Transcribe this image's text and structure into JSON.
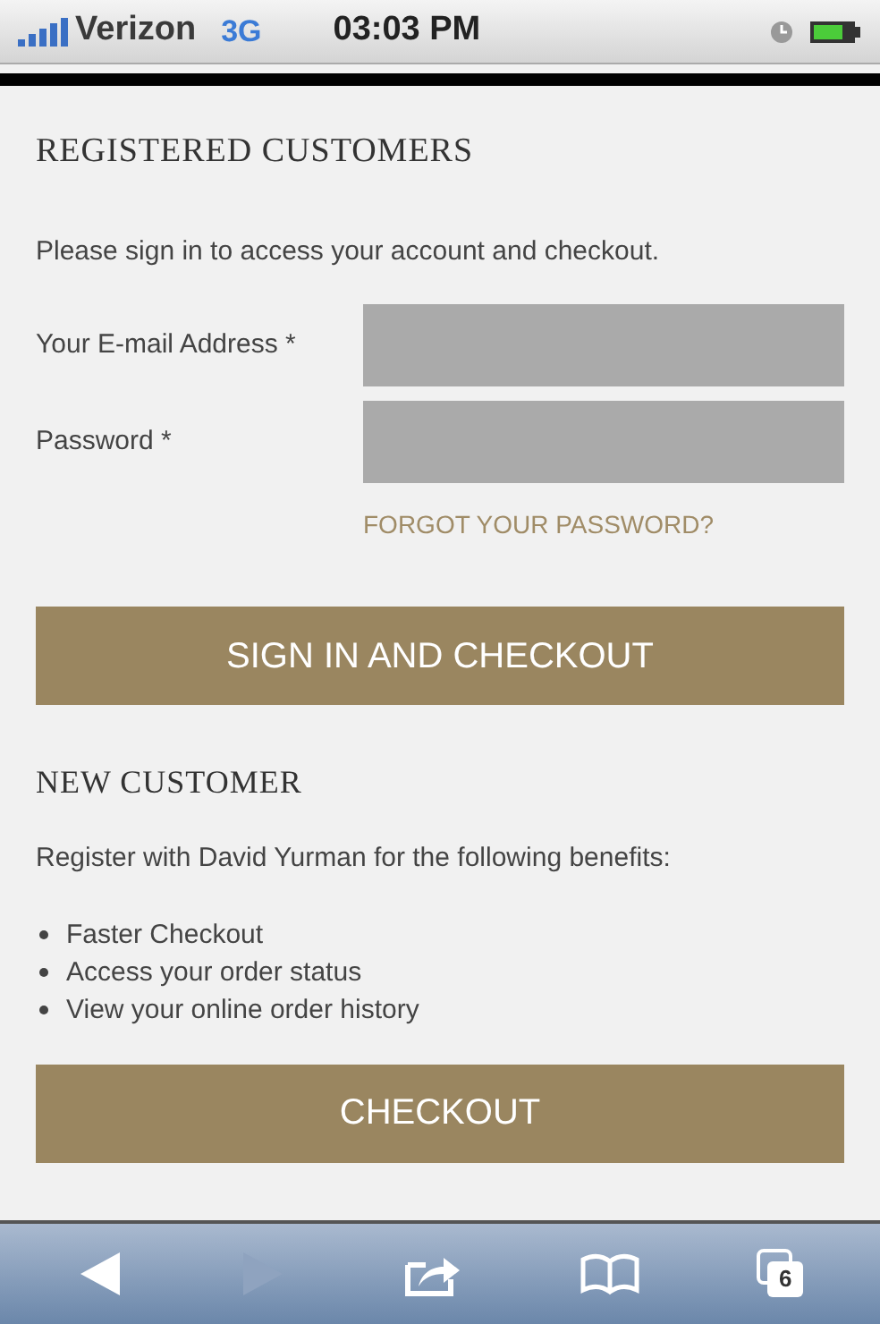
{
  "status_bar": {
    "carrier": "Verizon",
    "network": "3G",
    "time": "03:03 PM"
  },
  "registered": {
    "title": "REGISTERED CUSTOMERS",
    "intro": "Please sign in to access your account and checkout.",
    "fields": [
      {
        "label": "Your E-mail Address *"
      },
      {
        "label": "Password *"
      }
    ],
    "forgot": "FORGOT YOUR PASSWORD?",
    "button": "SIGN IN AND CHECKOUT"
  },
  "new_customer": {
    "title": "NEW CUSTOMER",
    "intro": "Register with David Yurman for the following benefits:",
    "benefits": [
      "Faster Checkout",
      "Access your order status",
      "View your online order history"
    ],
    "button": "CHECKOUT"
  },
  "toolbar": [
    {
      "kind": "back",
      "disabled": false
    },
    {
      "kind": "forward",
      "disabled": true
    },
    {
      "kind": "share",
      "disabled": false
    },
    {
      "kind": "bookmarks",
      "disabled": false
    },
    {
      "kind": "tabs",
      "disabled": false,
      "count": "6"
    }
  ]
}
